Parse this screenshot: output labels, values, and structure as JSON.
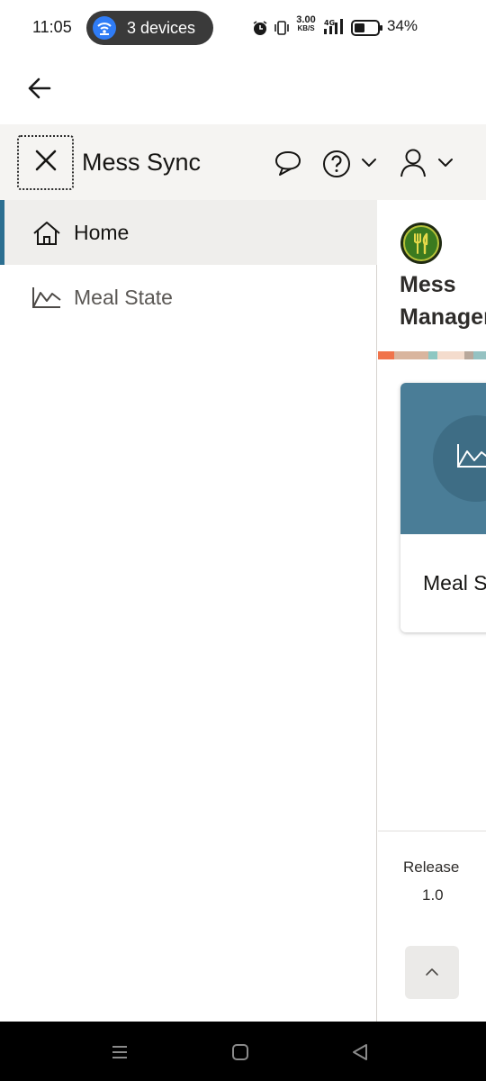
{
  "status_bar": {
    "time": "11:05",
    "devices_label": "3 devices",
    "speed_value": "3.00",
    "speed_unit": "KB/S",
    "network": "4G",
    "battery_pct": "34%",
    "icons": [
      "hotspot-icon",
      "alarm-icon",
      "vibrate-icon",
      "signal-icon",
      "battery-icon"
    ]
  },
  "back_bar": {
    "icon": "back-arrow-icon"
  },
  "header": {
    "title": "Mess Sync",
    "icons": [
      "close-icon",
      "chat-icon",
      "help-icon",
      "chevron-down-icon",
      "user-icon",
      "chevron-down-icon"
    ]
  },
  "sidebar": {
    "items": [
      {
        "label": "Home",
        "icon": "home-icon",
        "active": true
      },
      {
        "label": "Meal State",
        "icon": "chart-icon",
        "active": false
      }
    ]
  },
  "main": {
    "app_name_line1": "Mess",
    "app_name_line2": "Management",
    "logo_icon": "fork-knife-icon",
    "stripe_colors": [
      "#f0734a",
      "#d9b59e",
      "#8ec7c2",
      "#f4dccd",
      "#b9a89b",
      "#95c2c2"
    ],
    "card": {
      "label": "Meal State",
      "icon": "chart-icon",
      "color": "#4a7d97"
    },
    "release_label": "Release",
    "release_version": "1.0",
    "scroll_top_icon": "chevron-up-icon"
  },
  "system_nav": {
    "icons": [
      "recent-apps-icon",
      "home-square-icon",
      "back-triangle-icon"
    ]
  },
  "colors": {
    "accent": "#2c6f91",
    "header_bg": "#f5f4f2",
    "active_bg": "#efeeec"
  }
}
